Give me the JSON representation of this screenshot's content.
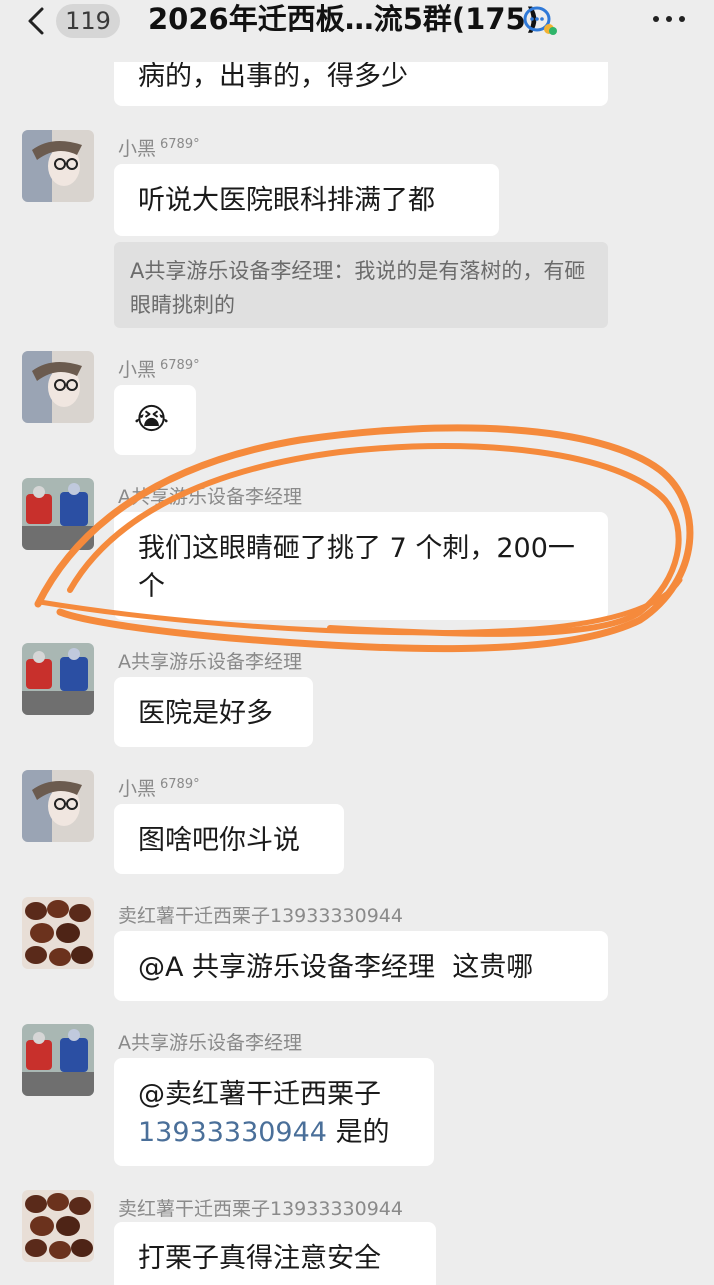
{
  "header": {
    "badge_count": "119",
    "title": "2026年迁西板…流5群(175)"
  },
  "messages": [
    {
      "id": "m0",
      "sender": "",
      "sender_tag": "",
      "text": "病的，出事的，得多少"
    },
    {
      "id": "m1",
      "sender": "小黑",
      "sender_tag": "6789°",
      "text": "听说大医院眼科排满了都",
      "quote": "A共享游乐设备李经理：我说的是有落树的，有砸眼睛挑刺的"
    },
    {
      "id": "m2",
      "sender": "小黑",
      "sender_tag": "6789°",
      "emoji": "😭"
    },
    {
      "id": "m3",
      "sender": "A共享游乐设备李经理",
      "text": "我们这眼睛砸了挑了 7 个刺，200一个"
    },
    {
      "id": "m4",
      "sender": "A共享游乐设备李经理",
      "text": "医院是好多"
    },
    {
      "id": "m5",
      "sender": "小黑",
      "sender_tag": "6789°",
      "text": "图啥吧你斗说"
    },
    {
      "id": "m6",
      "sender": "卖红薯干迁西栗子13933330944",
      "text_mention": "@A 共享游乐设备李经理",
      "text_after": "这贵哪"
    },
    {
      "id": "m7",
      "sender": "A共享游乐设备李经理",
      "text_mention": "@卖红薯干迁西栗子",
      "text_phone": "13933330944",
      "text_after": "是的"
    },
    {
      "id": "m8",
      "sender": "卖红薯干迁西栗子13933330944",
      "text": "打栗子真得注意安全"
    }
  ],
  "colors": {
    "background": "#ededed",
    "bubble": "#ffffff",
    "annotation": "#f58a3c",
    "link": "#4a6f99"
  },
  "icons": {
    "back": "chevron-left-icon",
    "group_tag": "chat-bubbles-icon",
    "more": "more-dots-icon"
  }
}
